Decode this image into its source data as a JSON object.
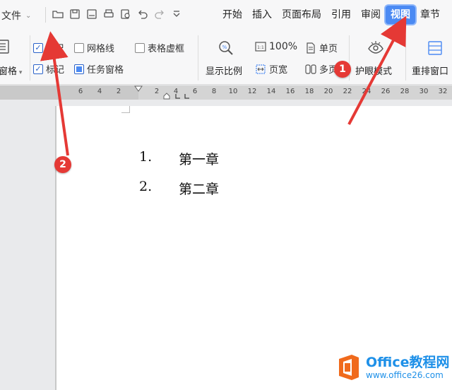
{
  "menubar": {
    "file_label": "文件",
    "tabs": [
      {
        "label": "开始",
        "active": false
      },
      {
        "label": "插入",
        "active": false
      },
      {
        "label": "页面布局",
        "active": false
      },
      {
        "label": "引用",
        "active": false
      },
      {
        "label": "审阅",
        "active": false
      },
      {
        "label": "视图",
        "active": true
      },
      {
        "label": "章节",
        "active": false
      }
    ],
    "quick_access_icons": [
      "open-folder-icon",
      "save-icon",
      "export-pdf-icon",
      "print-icon",
      "print-preview-icon",
      "undo-icon",
      "redo-icon",
      "customize-dropdown-icon"
    ]
  },
  "ribbon": {
    "pane_label": "窗格",
    "show": {
      "ruler": {
        "label": "标尺",
        "checked": true
      },
      "gridlines": {
        "label": "网格线",
        "checked": false
      },
      "table_gridlines": {
        "label": "表格虚框",
        "checked": false
      },
      "markup": {
        "label": "标记",
        "checked": true
      },
      "task_pane": {
        "label": "任务窗格",
        "checked": true
      }
    },
    "zoom": {
      "label": "显示比例",
      "percent_label": "100%",
      "page_width_label": "页宽",
      "single_page_label": "单页",
      "multi_page_label": "多页"
    },
    "eye_protection_label": "护眼模式",
    "rearrange_label": "重排窗口"
  },
  "ruler": {
    "left_ticks": [
      "6",
      "4",
      "2"
    ],
    "right_ticks": [
      "2",
      "4",
      "6",
      "8",
      "10",
      "12",
      "14",
      "16",
      "18",
      "20",
      "22",
      "24",
      "26",
      "28",
      "30",
      "32"
    ]
  },
  "document": {
    "items": [
      {
        "number": "1.",
        "text": "第一章"
      },
      {
        "number": "2.",
        "text": "第二章"
      }
    ]
  },
  "annotations": {
    "badge1": "1",
    "badge2": "2"
  },
  "watermark": {
    "brand": "Office教程网",
    "url": "www.office26.com"
  },
  "colors": {
    "accent": "#4b8af3",
    "annotation": "#e53935",
    "watermark": "#1e90e8"
  }
}
